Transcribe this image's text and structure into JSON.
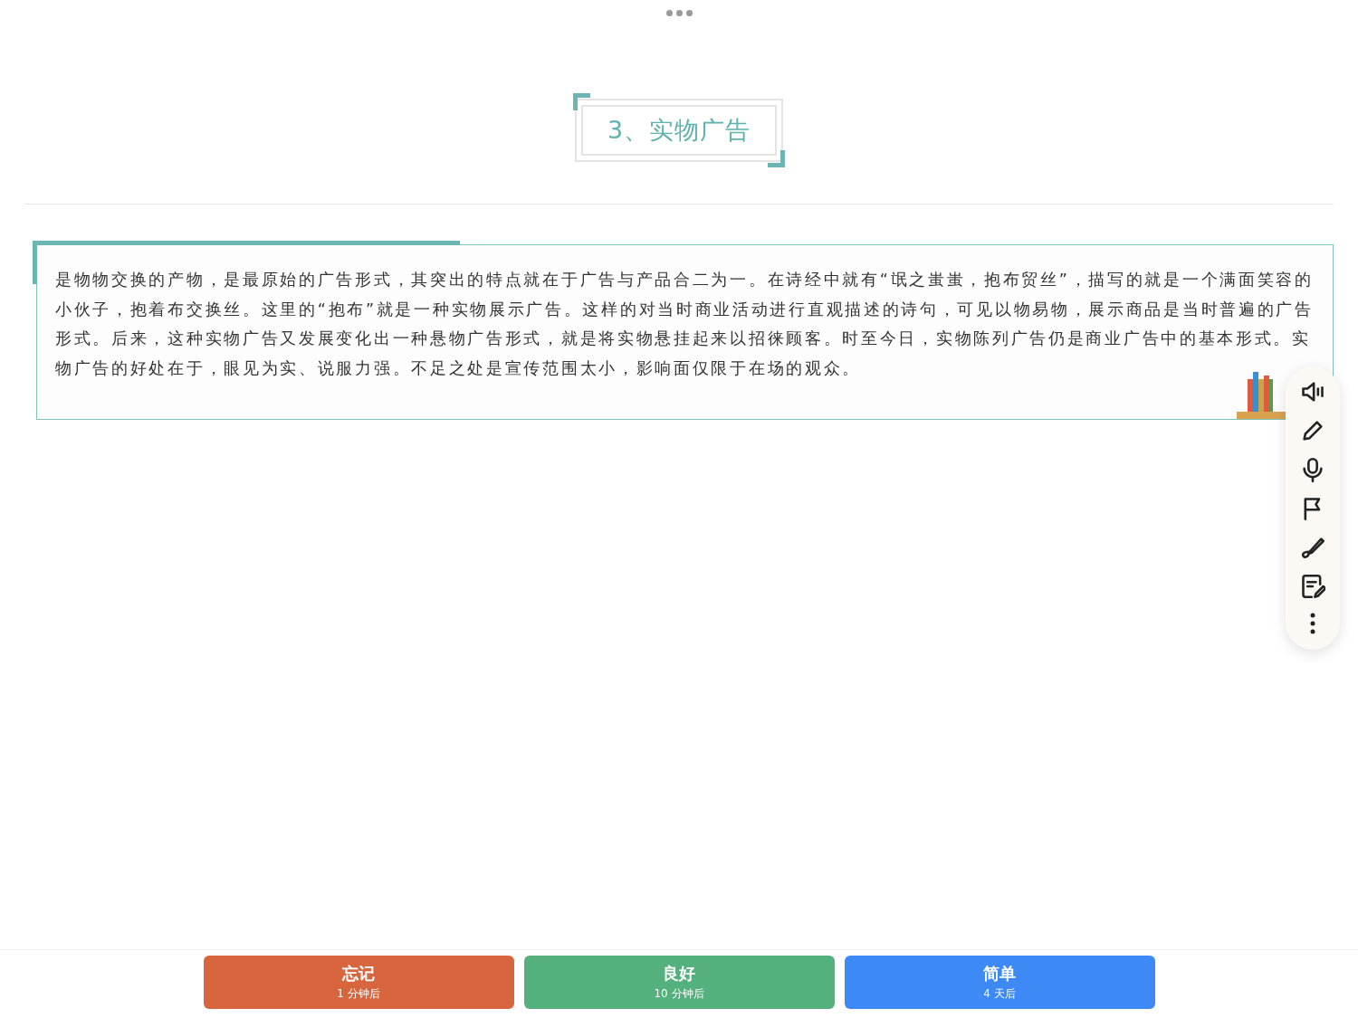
{
  "heading": "3、实物广告",
  "paragraph": "是物物交换的产物，是最原始的广告形式，其突出的特点就在于广告与产品合二为一。在诗经中就有“氓之蚩蚩，抱布贸丝”，描写的就是一个满面笑容的小伙子，抱着布交换丝。这里的“抱布”就是一种实物展示广告。这样的对当时商业活动进行直观描述的诗句，可见以物易物，展示商品是当时普遍的广告形式。后来，这种实物广告又发展变化出一种悬物广告形式，就是将实物悬挂起来以招徕顾客。时至今日，实物陈列广告仍是商业广告中的基本形式。实物广告的好处在于，眼见为实、说服力强。不足之处是宣传范围太小，影响面仅限于在场的观众。",
  "answer_buttons": [
    {
      "label": "忘记",
      "interval": "1 分钟后",
      "color": "#d7663e"
    },
    {
      "label": "良好",
      "interval": "10 分钟后",
      "color": "#54b07c"
    },
    {
      "label": "简单",
      "interval": "4 天后",
      "color": "#3d8af7"
    }
  ]
}
